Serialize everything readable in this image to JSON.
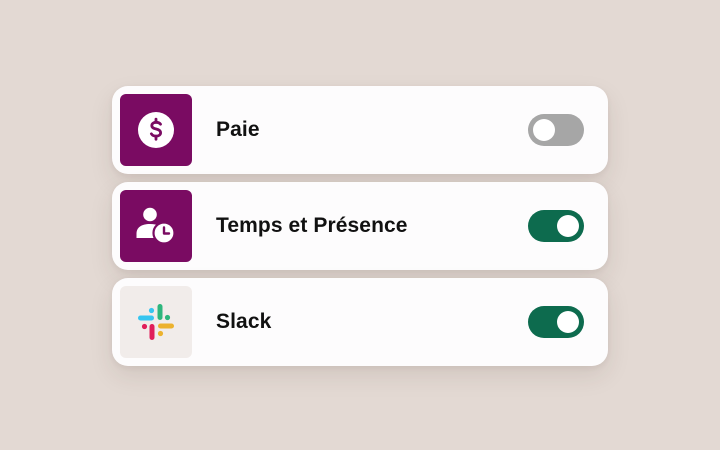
{
  "colors": {
    "background": "#e3d9d3",
    "card": "#fdfcfd",
    "brand_purple": "#7a0b62",
    "toggle_on": "#0d6b4e",
    "toggle_off": "#a6a6a6"
  },
  "integrations": [
    {
      "label": "Paie",
      "icon": "dollar-icon",
      "enabled": false
    },
    {
      "label": "Temps et Présence",
      "icon": "user-clock-icon",
      "enabled": true
    },
    {
      "label": "Slack",
      "icon": "slack-logo-icon",
      "enabled": true
    }
  ]
}
